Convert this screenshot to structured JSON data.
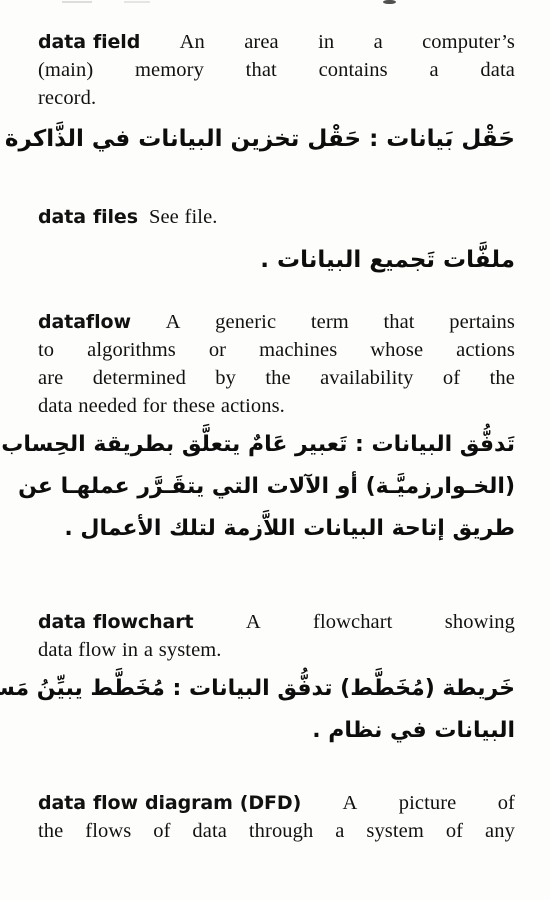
{
  "page": {
    "language_primary": "English",
    "language_secondary": "Arabic",
    "type": "bilingual-dictionary-page",
    "background_color": "#fdfdfc",
    "text_color": "#111111"
  },
  "entries": [
    {
      "term": "data field",
      "definition_lines": [
        [
          "An",
          "area",
          "in",
          "a",
          "computer’s"
        ],
        [
          "(main)",
          "memory",
          "that",
          "contains",
          "a",
          "data"
        ],
        [
          "record."
        ]
      ],
      "definition_plain": "An area in a computer’s (main) memory that contains a data record.",
      "arabic_lines": [
        "حَقْل بَيانات : حَقْل تخزين البيانات في الذَّاكرة ."
      ]
    },
    {
      "term": "data files",
      "definition_lines": [
        [
          "See file."
        ]
      ],
      "definition_plain": "See file.",
      "arabic_lines": [
        "ملفَّات تَجميع البيانات ."
      ]
    },
    {
      "term": "dataflow",
      "definition_lines": [
        [
          "A",
          "generic",
          "term",
          "that",
          "pertains"
        ],
        [
          "to",
          "algorithms",
          "or",
          "machines",
          "whose",
          "actions"
        ],
        [
          "are",
          "determined",
          "by",
          "the",
          "availability",
          "of",
          "the"
        ],
        [
          "data needed for these actions."
        ]
      ],
      "definition_plain": "A generic term that pertains to algorithms or machines whose actions are determined by the availability of the data needed for these actions.",
      "arabic_lines": [
        "تَدفُّق البيانات : تَعبير عَامٌ يتعلَّق بطريقة الحِساب",
        "(الخـوارزميَّـة) أو الآلات التي يتقَـرَّر عملهـا عن",
        "طريق إتاحة البيانات اللاَّزمة لتلك الأعمال ."
      ]
    },
    {
      "term": "data flowchart",
      "definition_lines": [
        [
          "A",
          "flowchart",
          "showing"
        ],
        [
          "data flow in a system."
        ]
      ],
      "definition_plain": "A flowchart showing data flow in a system.",
      "arabic_lines": [
        "خَريطة (مُخَطَّط) تدفُّق البيانات : مُخَطَّط يبيِّنُ مَسار",
        "البيانات في نظام ."
      ]
    },
    {
      "term": "data flow diagram (DFD)",
      "definition_lines": [
        [
          "A",
          "picture",
          "of"
        ],
        [
          "the",
          "flows",
          "of",
          "data",
          "through",
          "a",
          "system",
          "of",
          "any"
        ]
      ],
      "definition_plain": "A picture of the flows of data through a system of any",
      "arabic_lines": []
    }
  ]
}
